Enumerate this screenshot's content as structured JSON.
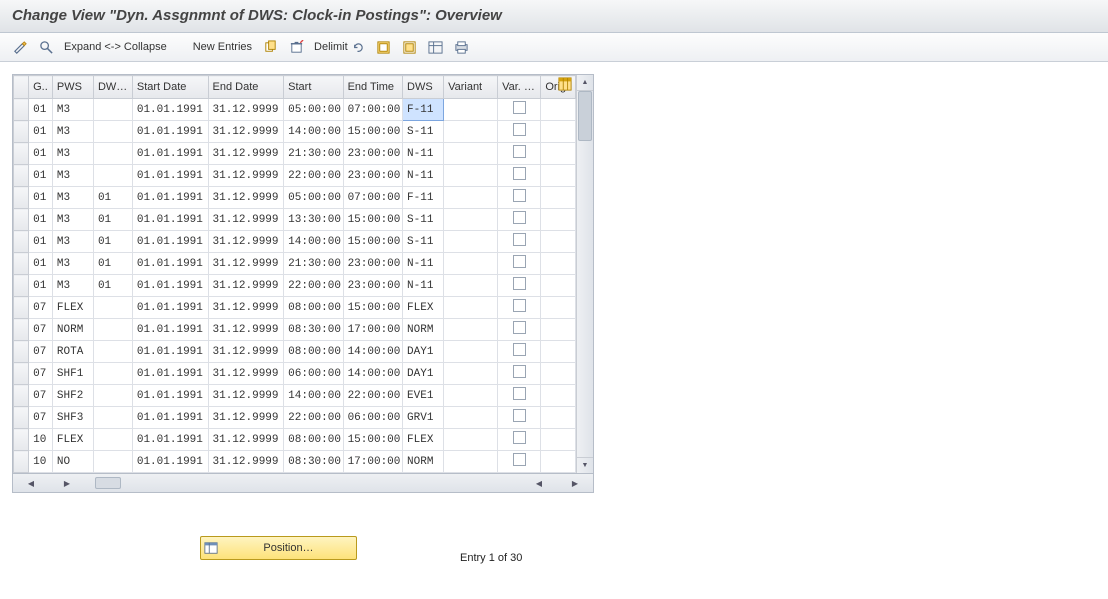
{
  "header": {
    "title": "Change View \"Dyn. Assgnmnt of DWS: Clock-in Postings\": Overview"
  },
  "toolbar": {
    "expand_collapse": "Expand <-> Collapse",
    "new_entries": "New Entries",
    "delimit": "Delimit"
  },
  "table": {
    "columns": [
      "G..",
      "PWS",
      "DW…",
      "Start Date",
      "End Date",
      "Start",
      "End Time",
      "DWS",
      "Variant",
      "Var. …",
      "Orig"
    ],
    "rows": [
      {
        "g": "01",
        "pws": "M3",
        "dw": "",
        "sd": "01.01.1991",
        "ed": "31.12.9999",
        "st": "05:00:00",
        "et": "07:00:00",
        "dws": "F-11",
        "var": "",
        "vf": false,
        "o": "",
        "sel": true
      },
      {
        "g": "01",
        "pws": "M3",
        "dw": "",
        "sd": "01.01.1991",
        "ed": "31.12.9999",
        "st": "14:00:00",
        "et": "15:00:00",
        "dws": "S-11",
        "var": "",
        "vf": false,
        "o": "",
        "sel": false
      },
      {
        "g": "01",
        "pws": "M3",
        "dw": "",
        "sd": "01.01.1991",
        "ed": "31.12.9999",
        "st": "21:30:00",
        "et": "23:00:00",
        "dws": "N-11",
        "var": "",
        "vf": false,
        "o": "",
        "sel": false
      },
      {
        "g": "01",
        "pws": "M3",
        "dw": "",
        "sd": "01.01.1991",
        "ed": "31.12.9999",
        "st": "22:00:00",
        "et": "23:00:00",
        "dws": "N-11",
        "var": "",
        "vf": false,
        "o": "",
        "sel": false
      },
      {
        "g": "01",
        "pws": "M3",
        "dw": "01",
        "sd": "01.01.1991",
        "ed": "31.12.9999",
        "st": "05:00:00",
        "et": "07:00:00",
        "dws": "F-11",
        "var": "",
        "vf": false,
        "o": "",
        "sel": false
      },
      {
        "g": "01",
        "pws": "M3",
        "dw": "01",
        "sd": "01.01.1991",
        "ed": "31.12.9999",
        "st": "13:30:00",
        "et": "15:00:00",
        "dws": "S-11",
        "var": "",
        "vf": false,
        "o": "",
        "sel": false
      },
      {
        "g": "01",
        "pws": "M3",
        "dw": "01",
        "sd": "01.01.1991",
        "ed": "31.12.9999",
        "st": "14:00:00",
        "et": "15:00:00",
        "dws": "S-11",
        "var": "",
        "vf": false,
        "o": "",
        "sel": false
      },
      {
        "g": "01",
        "pws": "M3",
        "dw": "01",
        "sd": "01.01.1991",
        "ed": "31.12.9999",
        "st": "21:30:00",
        "et": "23:00:00",
        "dws": "N-11",
        "var": "",
        "vf": false,
        "o": "",
        "sel": false
      },
      {
        "g": "01",
        "pws": "M3",
        "dw": "01",
        "sd": "01.01.1991",
        "ed": "31.12.9999",
        "st": "22:00:00",
        "et": "23:00:00",
        "dws": "N-11",
        "var": "",
        "vf": false,
        "o": "",
        "sel": false
      },
      {
        "g": "07",
        "pws": "FLEX",
        "dw": "",
        "sd": "01.01.1991",
        "ed": "31.12.9999",
        "st": "08:00:00",
        "et": "15:00:00",
        "dws": "FLEX",
        "var": "",
        "vf": false,
        "o": "",
        "sel": false
      },
      {
        "g": "07",
        "pws": "NORM",
        "dw": "",
        "sd": "01.01.1991",
        "ed": "31.12.9999",
        "st": "08:30:00",
        "et": "17:00:00",
        "dws": "NORM",
        "var": "",
        "vf": false,
        "o": "",
        "sel": false
      },
      {
        "g": "07",
        "pws": "ROTA",
        "dw": "",
        "sd": "01.01.1991",
        "ed": "31.12.9999",
        "st": "08:00:00",
        "et": "14:00:00",
        "dws": "DAY1",
        "var": "",
        "vf": false,
        "o": "",
        "sel": false
      },
      {
        "g": "07",
        "pws": "SHF1",
        "dw": "",
        "sd": "01.01.1991",
        "ed": "31.12.9999",
        "st": "06:00:00",
        "et": "14:00:00",
        "dws": "DAY1",
        "var": "",
        "vf": false,
        "o": "",
        "sel": false
      },
      {
        "g": "07",
        "pws": "SHF2",
        "dw": "",
        "sd": "01.01.1991",
        "ed": "31.12.9999",
        "st": "14:00:00",
        "et": "22:00:00",
        "dws": "EVE1",
        "var": "",
        "vf": false,
        "o": "",
        "sel": false
      },
      {
        "g": "07",
        "pws": "SHF3",
        "dw": "",
        "sd": "01.01.1991",
        "ed": "31.12.9999",
        "st": "22:00:00",
        "et": "06:00:00",
        "dws": "GRV1",
        "var": "",
        "vf": false,
        "o": "",
        "sel": false
      },
      {
        "g": "10",
        "pws": "FLEX",
        "dw": "",
        "sd": "01.01.1991",
        "ed": "31.12.9999",
        "st": "08:00:00",
        "et": "15:00:00",
        "dws": "FLEX",
        "var": "",
        "vf": false,
        "o": "",
        "sel": false
      },
      {
        "g": "10",
        "pws": "NO",
        "dw": "",
        "sd": "01.01.1991",
        "ed": "31.12.9999",
        "st": "08:30:00",
        "et": "17:00:00",
        "dws": "NORM",
        "var": "",
        "vf": false,
        "o": "",
        "sel": false
      }
    ]
  },
  "footer": {
    "position_btn": "Position…",
    "entry_text": "Entry 1 of 30"
  }
}
